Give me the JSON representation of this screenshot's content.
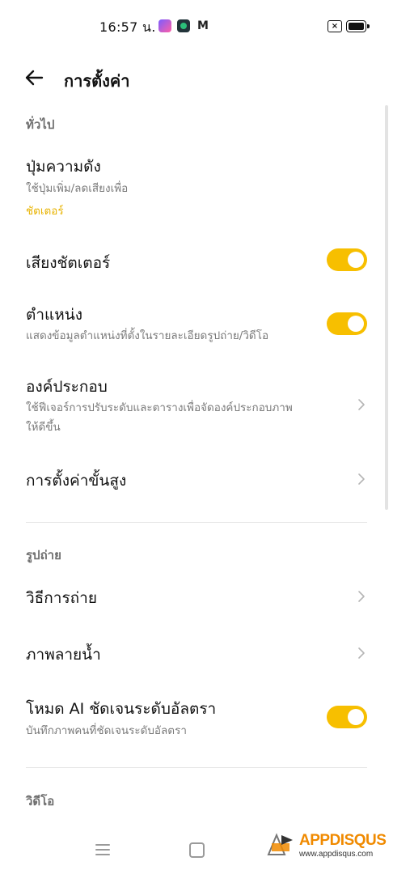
{
  "status_bar": {
    "time": "16:57 น.",
    "icons": [
      "shortcut-app-icon",
      "green-app-icon",
      "gmail-icon",
      "notification-muted-icon",
      "battery-icon"
    ]
  },
  "header": {
    "back_icon": "arrow-left-icon",
    "title": "การตั้งค่า"
  },
  "sections": {
    "general": "ทั่วไป",
    "photo": "รูปถ่าย",
    "video": "วิดีโอ"
  },
  "rows": {
    "volume_button": {
      "title": "ปุ่มความดัง",
      "subtitle": "ใช้ปุ่มเพิ่ม/ลดเสียงเพื่อ",
      "value": "ชัตเตอร์"
    },
    "shutter_sound": {
      "title": "เสียงชัตเตอร์",
      "toggle_on": true
    },
    "location": {
      "title": "ตำแหน่ง",
      "subtitle": "แสดงข้อมูลตำแหน่งที่ตั้งในรายละเอียดรูปถ่าย/วิดีโอ",
      "toggle_on": true
    },
    "composition": {
      "title": "องค์ประกอบ",
      "subtitle_line1": "ใช้ฟีเจอร์การปรับระดับและตารางเพื่อจัดองค์ประกอบภาพ",
      "subtitle_line2": "ให้ดีขึ้น"
    },
    "advanced": {
      "title": "การตั้งค่าขั้นสูง"
    },
    "shooting_method": {
      "title": "วิธีการถ่าย"
    },
    "watermark": {
      "title": "ภาพลายน้ำ"
    },
    "ai_ultra_clear": {
      "title": "โหมด AI ชัดเจนระดับอัลตรา",
      "subtitle": "บันทึกภาพคนที่ชัดเจนระดับอัลตรา",
      "toggle_on": true
    }
  },
  "watermark_overlay": {
    "logo": "APPDISQUS",
    "url": "www.appdisqus.com"
  },
  "colors": {
    "accent": "#f7bf00",
    "accent_text": "#e8b300",
    "subtitle": "#7a7a7a",
    "section_header": "#6e6e6e"
  }
}
